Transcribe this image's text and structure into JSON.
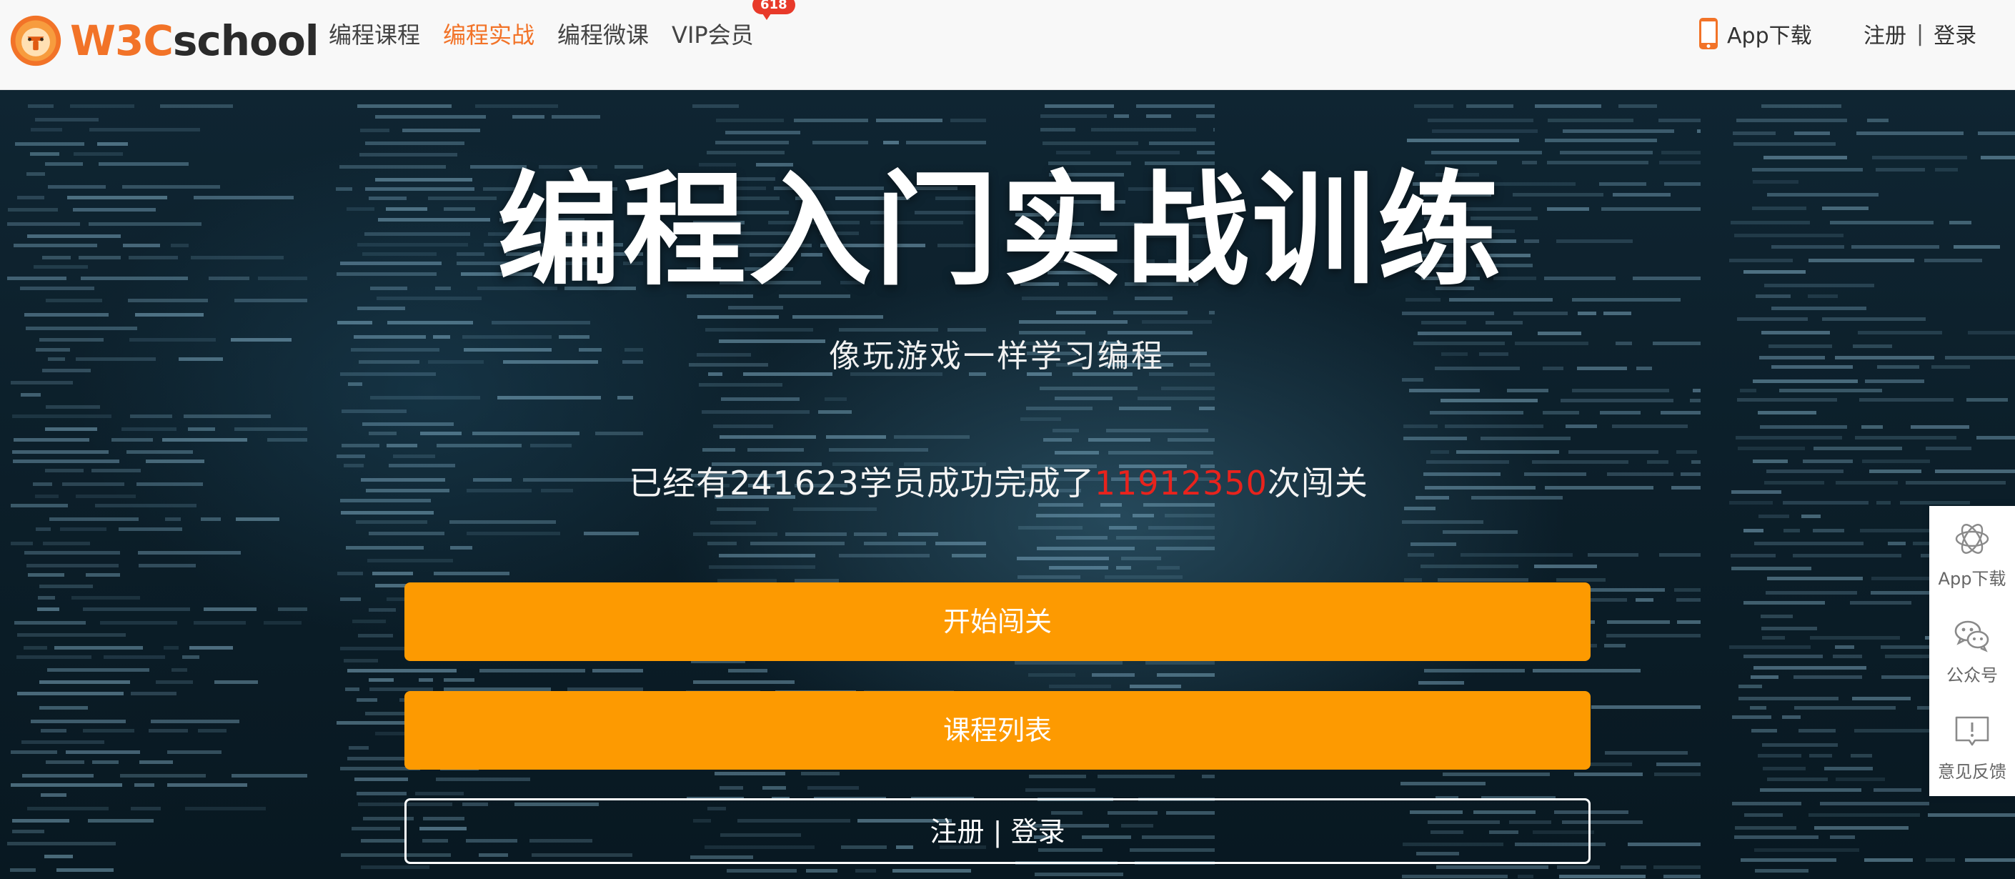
{
  "brand": {
    "logo_w3c": "W3C",
    "logo_school": "school",
    "accent": "#f27328"
  },
  "nav": {
    "items": [
      {
        "label": "编程课程",
        "active": false
      },
      {
        "label": "编程实战",
        "active": true
      },
      {
        "label": "编程微课",
        "active": false
      },
      {
        "label": "VIP会员",
        "active": false,
        "badge": "618"
      }
    ]
  },
  "header": {
    "app_download": "App下载",
    "register": "注册",
    "separator": "|",
    "login": "登录"
  },
  "hero": {
    "title": "编程入门实战训练",
    "subtitle": "像玩游戏一样学习编程",
    "stats_prefix": "已经有",
    "learners": "241623",
    "stats_middle": "学员成功完成了",
    "clears": "11912350",
    "stats_suffix": "次闯关",
    "highlight_color": "#e8231d"
  },
  "buttons": {
    "start": "开始闯关",
    "course_list": "课程列表",
    "register": "注册",
    "separator": "|",
    "login": "登录",
    "orange": "#fd9a01"
  },
  "side_bar": {
    "items": [
      {
        "label": "App下载",
        "icon": "app-logo-icon"
      },
      {
        "label": "公众号",
        "icon": "wechat-icon"
      },
      {
        "label": "意见反馈",
        "icon": "feedback-icon"
      }
    ]
  }
}
